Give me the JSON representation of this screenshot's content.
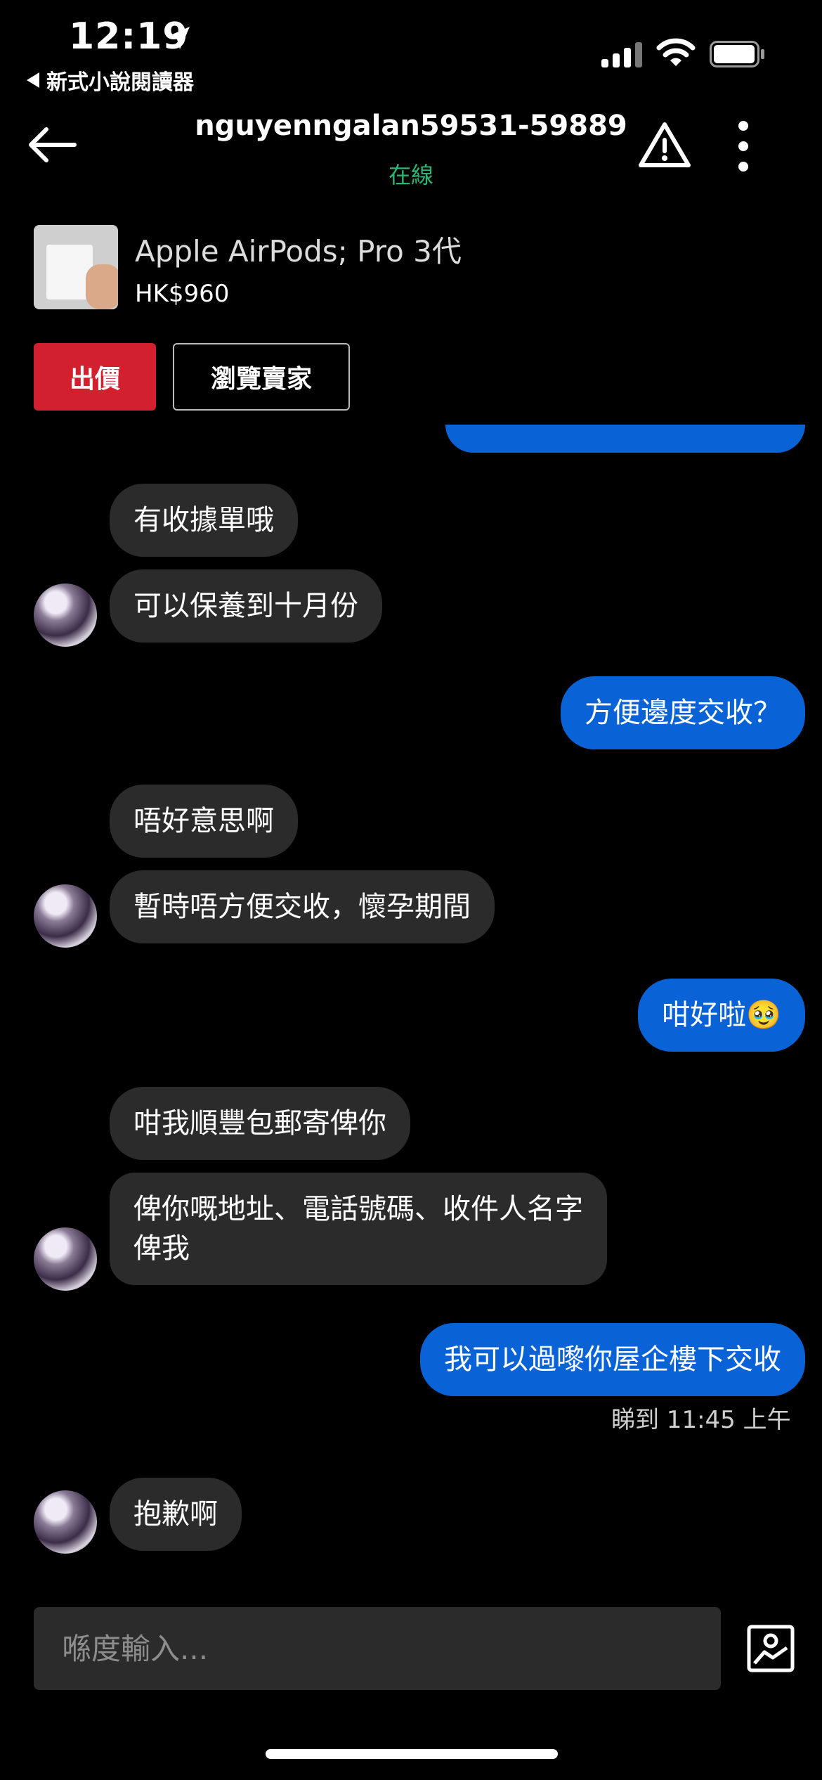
{
  "status_bar": {
    "time": "12:19",
    "back_app": "新式小說閱讀器"
  },
  "header": {
    "title": "nguyenngalan59531-59889",
    "status": "在線"
  },
  "product": {
    "name": "Apple AirPods; Pro 3代",
    "price": "HK$960",
    "offer_button": "出價",
    "browse_seller_button": "瀏覽賣家"
  },
  "messages": [
    {
      "from": "seller",
      "text": "有收據單哦"
    },
    {
      "from": "seller",
      "text": "可以保養到十月份"
    },
    {
      "from": "me",
      "text": "方便邊度交收？"
    },
    {
      "from": "seller",
      "text": "唔好意思啊"
    },
    {
      "from": "seller",
      "text": "暫時唔方便交收，懷孕期間"
    },
    {
      "from": "me",
      "text": "咁好啦🥹"
    },
    {
      "from": "seller",
      "text": "咁我順豐包郵寄俾你"
    },
    {
      "from": "seller",
      "text": "俾你嘅地址、電話號碼、收件人名字\n俾我"
    },
    {
      "from": "me",
      "text": "我可以過嚟你屋企樓下交收"
    },
    {
      "from": "seller",
      "text": "抱歉啊"
    }
  ],
  "read_receipt": "睇到 11:45 上午",
  "composer": {
    "placeholder": "喺度輸入..."
  },
  "colors": {
    "accent_red": "#d3202e",
    "outgoing_bubble": "#0963d6",
    "incoming_bubble": "#2b2b2b",
    "online_green": "#2bb673"
  },
  "icons": [
    "location-arrow-icon",
    "signal-icon",
    "wifi-icon",
    "battery-icon",
    "back-arrow-icon",
    "warning-icon",
    "more-icon",
    "image-upload-icon"
  ]
}
